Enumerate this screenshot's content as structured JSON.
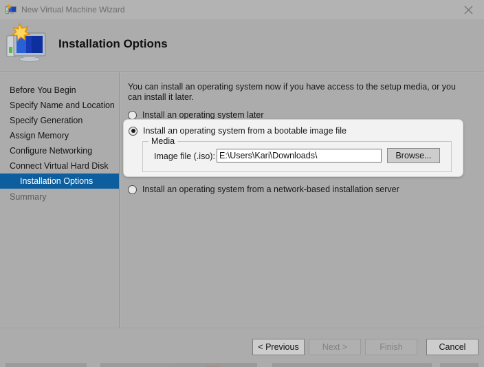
{
  "window": {
    "title": "New Virtual Machine Wizard",
    "icon": "virtual-machine-icon",
    "close_label": "✕"
  },
  "header": {
    "title": "Installation Options",
    "icon": "virtual-machine-large-icon"
  },
  "sidebar": {
    "items": [
      {
        "label": "Before You Begin",
        "selected": false,
        "dim": false
      },
      {
        "label": "Specify Name and Location",
        "selected": false,
        "dim": false
      },
      {
        "label": "Specify Generation",
        "selected": false,
        "dim": false
      },
      {
        "label": "Assign Memory",
        "selected": false,
        "dim": false
      },
      {
        "label": "Configure Networking",
        "selected": false,
        "dim": false
      },
      {
        "label": "Connect Virtual Hard Disk",
        "selected": false,
        "dim": false
      },
      {
        "label": "Installation Options",
        "selected": true,
        "dim": false
      },
      {
        "label": "Summary",
        "selected": false,
        "dim": true
      }
    ],
    "selected_bg": "#0c5e9e"
  },
  "main": {
    "intro": "You can install an operating system now if you have access to the setup media, or you can install it later.",
    "options": [
      {
        "label": "Install an operating system later",
        "checked": false
      },
      {
        "label": "Install an operating system from a bootable image file",
        "checked": true
      },
      {
        "label": "Install an operating system from a network-based installation server",
        "checked": false
      }
    ],
    "media_group": {
      "title": "Media",
      "field_label": "Image file (.iso):",
      "field_value": "E:\\Users\\Kari\\Downloads\\",
      "field_placeholder": "",
      "browse_label": "Browse..."
    }
  },
  "footer": {
    "buttons": [
      {
        "label": "< Previous",
        "disabled": false
      },
      {
        "label": "Next >",
        "disabled": true
      },
      {
        "label": "Finish",
        "disabled": true
      },
      {
        "label": "Cancel",
        "disabled": false
      }
    ]
  },
  "colors": {
    "window_bg": "#abacab",
    "titlebar_bg": "#b3b3b3",
    "accent": "#0c5e9e",
    "card_bg": "#f2f2f2"
  }
}
